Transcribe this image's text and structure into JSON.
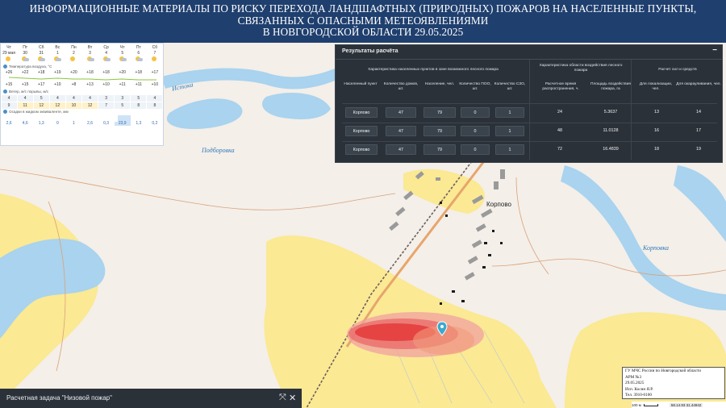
{
  "header": {
    "line1": "ИНФОРМАЦИОННЫЕ МАТЕРИАЛЫ ПО РИСКУ ПЕРЕХОДА ЛАНДШАФТНЫХ (ПРИРОДНЫХ) ПОЖАРОВ НА НАСЕЛЕННЫЕ ПУНКТЫ,",
    "line2": "СВЯЗАННЫХ С ОПАСНЫМИ МЕТЕОЯВЛЕНИЯМИ",
    "line3": "В НОВГОРОДСКОЙ ОБЛАСТИ 29.05.2025"
  },
  "weather": {
    "days": [
      {
        "name": "Чт",
        "date": "29 мая"
      },
      {
        "name": "Пт",
        "date": "30"
      },
      {
        "name": "Сб",
        "date": "31"
      },
      {
        "name": "Вс",
        "date": "1"
      },
      {
        "name": "Пн",
        "date": "2"
      },
      {
        "name": "Вт",
        "date": "3"
      },
      {
        "name": "Ср",
        "date": "4"
      },
      {
        "name": "Чт",
        "date": "5"
      },
      {
        "name": "Пт",
        "date": "6"
      },
      {
        "name": "Сб",
        "date": "7"
      }
    ],
    "temp_label": "Температура воздуха, °С",
    "temp_high": [
      "+26",
      "+22",
      "+18",
      "+19",
      "+20",
      "+18",
      "+18",
      "+20",
      "+18",
      "+17"
    ],
    "temp_low": [
      "+15",
      "+15",
      "+17",
      "+10",
      "+8",
      "+13",
      "+10",
      "+11",
      "+11",
      "+10"
    ],
    "wind_label": "Ветер, м/с порывы, м/с",
    "wind": [
      "4",
      "4",
      "5",
      "4",
      "4",
      "4",
      "3",
      "3",
      "5",
      "4"
    ],
    "gusts": [
      "9",
      "11",
      "12",
      "12",
      "10",
      "12",
      "7",
      "5",
      "8",
      "8"
    ],
    "precip_label": "Осадки в жидком эквиваленте, мм",
    "precip": [
      "2,6",
      "4,6",
      "1,3",
      "0",
      "1",
      "2,6",
      "0,3",
      "23,9",
      "1,3",
      "0,2"
    ]
  },
  "results": {
    "title": "Результаты расчёта",
    "minimize_glyph": "−",
    "group1": "Характеристика населенных пунктов в зоне возможного лесного пожара",
    "group2": "Характеристика области воздействия лесного пожара",
    "group3": "Расчет сил и средств",
    "columns": [
      "Населенный пункт",
      "Количество домов, шт.",
      "Население, чел.",
      "Количество ПОО, шт.",
      "Количество СЗО, шт.",
      "Расчетное время распространения, ч.",
      "Площадь воздействия пожара, га",
      "Для локализации, чел.",
      "Для окарауливания, чел."
    ],
    "rows": [
      {
        "place": "Корпово",
        "houses": "47",
        "population": "79",
        "poo": "0",
        "szo": "1",
        "time": "24",
        "area": "5.3637",
        "localization": "13",
        "patrol": "14"
      },
      {
        "place": "Корпово",
        "houses": "47",
        "population": "79",
        "poo": "0",
        "szo": "1",
        "time": "48",
        "area": "11.0128",
        "localization": "16",
        "patrol": "17"
      },
      {
        "place": "Корпово",
        "houses": "47",
        "population": "79",
        "poo": "0",
        "szo": "1",
        "time": "72",
        "area": "16.4839",
        "localization": "18",
        "patrol": "19"
      }
    ]
  },
  "taskbar": {
    "label": "Расчетная задача \"Низовой пожар\"",
    "expand_glyph": "⤧",
    "close_glyph": "✕"
  },
  "map": {
    "labels": {
      "istoka": "Истока",
      "podborovka": "Подборовка",
      "korpovka": "Корповка",
      "village": "Корпово"
    }
  },
  "stamp": {
    "line1": "ГУ МЧС России по Новгородской области",
    "line2": "АРМ №3",
    "line3": "29.05.2025",
    "line4": "Исп. Косин Я.Р.",
    "line5": "Тел. 3910-0100"
  },
  "scale": {
    "label": "100 м",
    "coords": "58.14.93 31.44942"
  },
  "colors": {
    "header": "#1f3f6e",
    "panel": "#2b3138",
    "water": "#a9d3ee",
    "field": "#fbe993",
    "fire": "#e63b3b",
    "marker": "#3aa9cf"
  }
}
